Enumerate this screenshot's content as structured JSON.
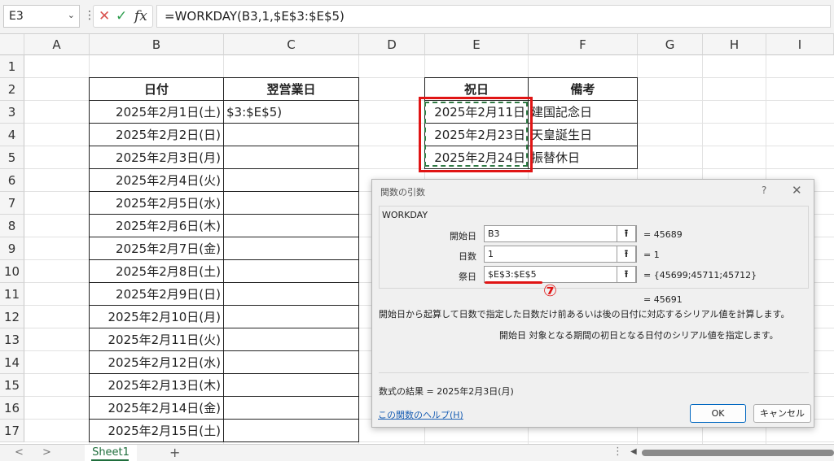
{
  "formula_bar": {
    "name_box": "E3",
    "cancel_icon": "x-icon",
    "enter_icon": "check-icon",
    "fx_label": "fx",
    "formula": "=WORKDAY(B3,1,$E$3:$E$5)"
  },
  "columns": [
    "A",
    "B",
    "C",
    "D",
    "E",
    "F",
    "G",
    "H",
    "I"
  ],
  "rows": [
    "1",
    "2",
    "3",
    "4",
    "5",
    "6",
    "7",
    "8",
    "9",
    "10",
    "11",
    "12",
    "13",
    "14",
    "15",
    "16",
    "17"
  ],
  "table1": {
    "header_date": "日付",
    "header_next": "翌営業日",
    "c3_value": "$3:$E$5)",
    "dates": [
      "2025年2月1日(土)",
      "2025年2月2日(日)",
      "2025年2月3日(月)",
      "2025年2月4日(火)",
      "2025年2月5日(水)",
      "2025年2月6日(木)",
      "2025年2月7日(金)",
      "2025年2月8日(土)",
      "2025年2月9日(日)",
      "2025年2月10日(月)",
      "2025年2月11日(火)",
      "2025年2月12日(水)",
      "2025年2月13日(木)",
      "2025年2月14日(金)",
      "2025年2月15日(土)"
    ]
  },
  "table2": {
    "header_holiday": "祝日",
    "header_note": "備考",
    "holidays": [
      "2025年2月11日",
      "2025年2月23日",
      "2025年2月24日"
    ],
    "notes": [
      "建国記念日",
      "天皇誕生日",
      "振替休日"
    ]
  },
  "dialog": {
    "title": "関数の引数",
    "help": "?",
    "close": "✕",
    "function_name": "WORKDAY",
    "args": [
      {
        "label": "開始日",
        "value": "B3",
        "result": "=  45689"
      },
      {
        "label": "日数",
        "value": "1",
        "result": "=  1"
      },
      {
        "label": "祭日",
        "value": "$E$3:$E$5",
        "result": "=  {45699;45711;45712}"
      }
    ],
    "step_marker": "⑦",
    "total": "=  45691",
    "description": "開始日から起算して日数で指定した日数だけ前あるいは後の日付に対応するシリアル値を計算します。",
    "arg_description": "開始日   対象となる期間の初日となる日付のシリアル値を指定します。",
    "result_text": "数式の結果 =   2025年2月3日(月)",
    "help_link": "この関数のヘルプ(H)",
    "ok": "OK",
    "cancel": "キャンセル"
  },
  "sheet_tabs": {
    "sheet_name": "Sheet1",
    "add": "+",
    "prev": "<",
    "next": ">"
  }
}
